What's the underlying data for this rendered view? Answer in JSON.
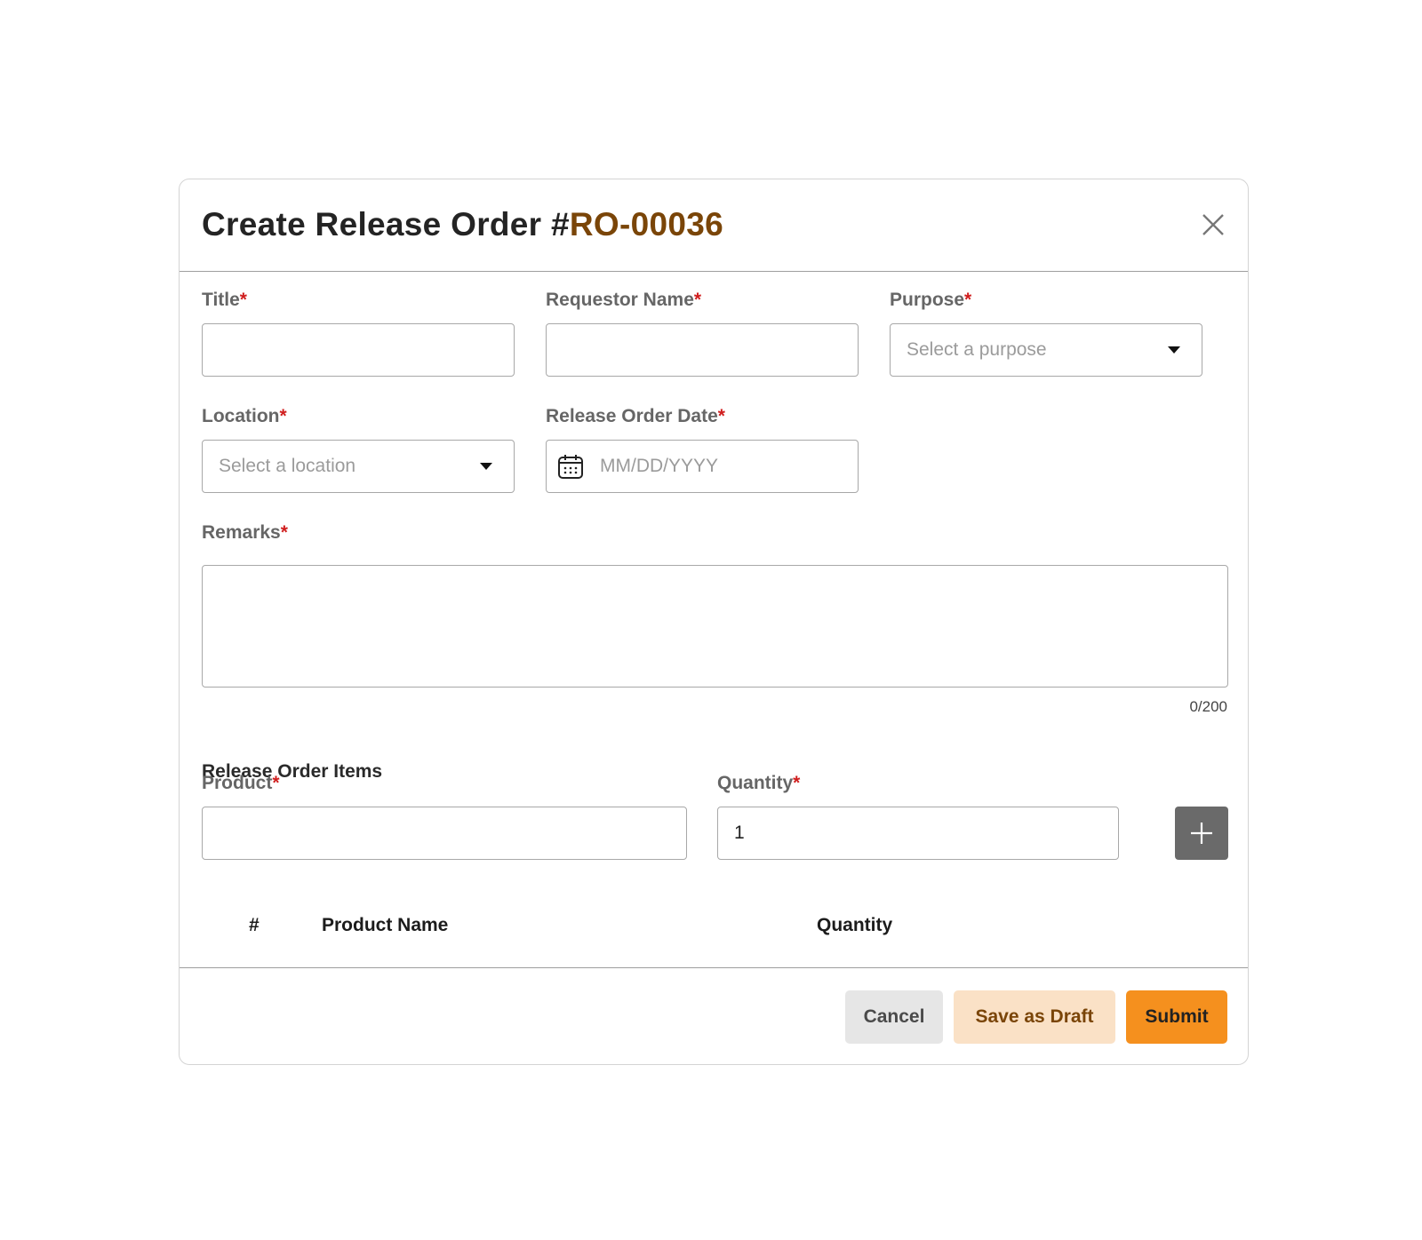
{
  "modal": {
    "title_prefix": "Create Release Order #",
    "order_number": "RO-00036",
    "close_icon": "close-icon",
    "brand_color": "#7a4508",
    "accent_color": "#f5901e"
  },
  "form": {
    "title": {
      "label": "Title",
      "required_mark": "*",
      "value": ""
    },
    "requestor_name": {
      "label": "Requestor Name",
      "required_mark": "*",
      "value": ""
    },
    "purpose": {
      "label": "Purpose",
      "required_mark": "*",
      "placeholder": "Select a purpose",
      "icon": "chevron-down-icon"
    },
    "location": {
      "label": "Location",
      "required_mark": "*",
      "placeholder": "Select a location",
      "icon": "chevron-down-icon"
    },
    "release_order_date": {
      "label": "Release Order Date",
      "required_mark": "*",
      "placeholder": "MM/DD/YYYY",
      "icon": "calendar-icon"
    },
    "remarks": {
      "label": "Remarks",
      "required_mark": "*",
      "value": "",
      "counter": "0/200"
    }
  },
  "items": {
    "section_title": "Release Order Items",
    "product": {
      "label": "Product",
      "required_mark": "*",
      "value": ""
    },
    "quantity": {
      "label": "Quantity",
      "required_mark": "*",
      "value": "1"
    },
    "add_icon": "plus-icon",
    "table": {
      "columns": [
        "#",
        "Product Name",
        "Quantity"
      ],
      "rows": []
    }
  },
  "footer": {
    "cancel_label": "Cancel",
    "draft_label": "Save as Draft",
    "submit_label": "Submit"
  }
}
